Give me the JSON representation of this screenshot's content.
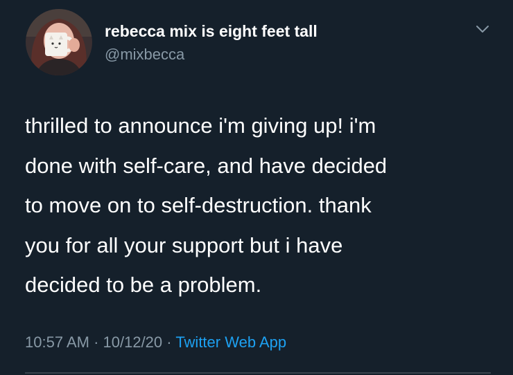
{
  "tweet": {
    "display_name": "rebecca mix is eight feet tall",
    "handle": "@mixbecca",
    "text_lines": [
      "thrilled to announce i'm giving up! i'm",
      "done with self-care, and have decided",
      "to move on to self-destruction. thank",
      "you for all your support but i have",
      "decided to be a problem."
    ],
    "time": "10:57 AM",
    "separator": " · ",
    "date": "10/12/20",
    "source": "Twitter Web App"
  },
  "icons": {
    "menu": "chevron-down-icon",
    "avatar": "profile-photo"
  },
  "colors": {
    "background": "#15202b",
    "primary_text": "#ffffff",
    "secondary_text": "#8899a6",
    "link": "#1da1f2",
    "divider": "#38444d"
  }
}
